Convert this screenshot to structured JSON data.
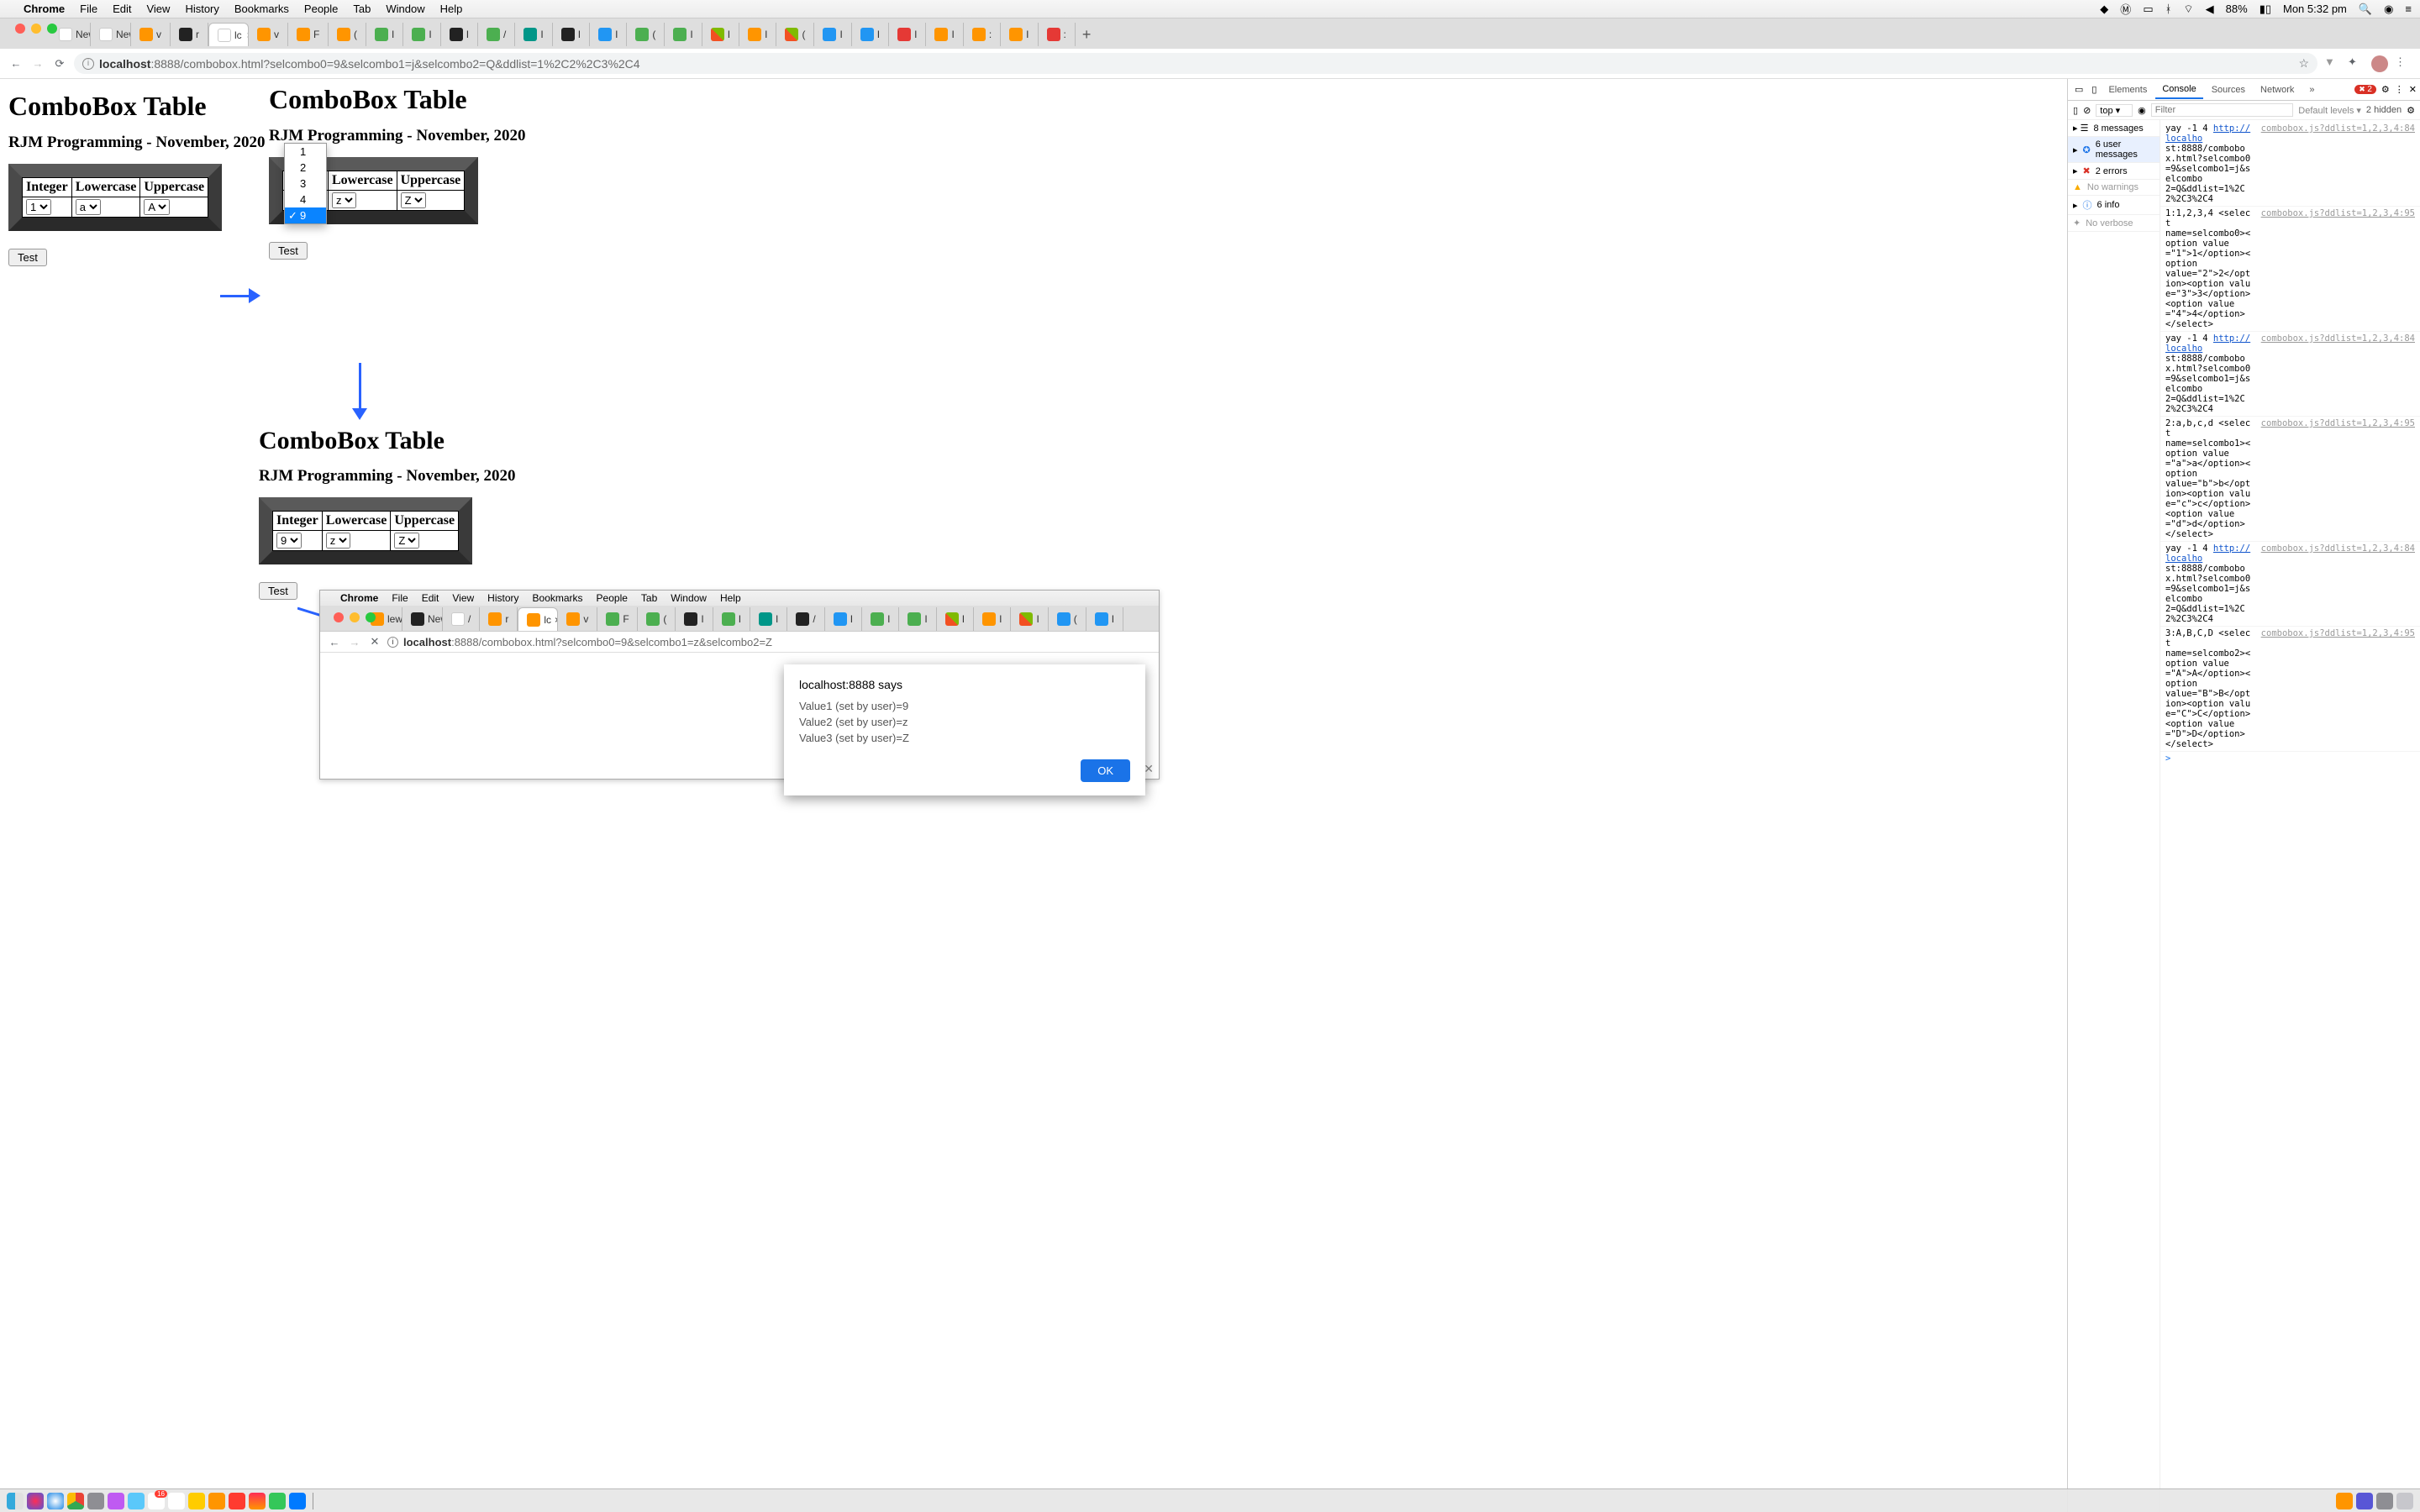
{
  "menubar": {
    "app": "Chrome",
    "items": [
      "File",
      "Edit",
      "View",
      "History",
      "Bookmarks",
      "People",
      "Tab",
      "Window",
      "Help"
    ],
    "battery": "88%",
    "clock": "Mon 5:32 pm"
  },
  "tabs": [
    {
      "label": "New"
    },
    {
      "label": "New"
    },
    {
      "label": "v"
    },
    {
      "label": "r"
    },
    {
      "label": "lc",
      "active": true,
      "close": "×"
    },
    {
      "label": "v"
    },
    {
      "label": "F"
    },
    {
      "label": "("
    },
    {
      "label": "I"
    },
    {
      "label": "I"
    },
    {
      "label": "I"
    },
    {
      "label": "/"
    },
    {
      "label": "I"
    },
    {
      "label": "I"
    },
    {
      "label": "I"
    },
    {
      "label": "("
    },
    {
      "label": "I"
    },
    {
      "label": "I"
    },
    {
      "label": "I"
    },
    {
      "label": "("
    },
    {
      "label": "I"
    },
    {
      "label": "I"
    },
    {
      "label": "I"
    },
    {
      "label": "I"
    },
    {
      "label": ":"
    },
    {
      "label": "I"
    },
    {
      "label": ":"
    }
  ],
  "url_prefix": "localhost",
  "url_rest": ":8888/combobox.html?selcombo0=9&selcombo1=j&selcombo2=Q&ddlist=1%2C2%2C3%2C4",
  "page_title": "ComboBox Table",
  "page_subtitle": "RJM Programming - November, 2020",
  "table_headers": [
    "Integer",
    "Lowercase",
    "Uppercase"
  ],
  "p1_vals": [
    "1",
    "a",
    "A"
  ],
  "p2_vals_partial_header": "r",
  "p2_vals": [
    "z",
    "Z"
  ],
  "p3_vals": [
    "9",
    "z",
    "Z"
  ],
  "test_label": "Test",
  "dropdown_options": [
    "1",
    "2",
    "3",
    "4",
    "9"
  ],
  "dropdown_selected_index": 4,
  "sub_menubar_items": [
    "Chrome",
    "File",
    "Edit",
    "View",
    "History",
    "Bookmarks",
    "People",
    "Tab",
    "Window",
    "Help"
  ],
  "sub_tabs": [
    {
      "label": "lew"
    },
    {
      "label": "New"
    },
    {
      "label": "/"
    },
    {
      "label": "r"
    },
    {
      "label": "lc",
      "active": true,
      "close": "×"
    },
    {
      "label": "v"
    },
    {
      "label": "F"
    },
    {
      "label": "("
    },
    {
      "label": "I"
    },
    {
      "label": "I"
    },
    {
      "label": "I"
    },
    {
      "label": "/"
    },
    {
      "label": "I"
    },
    {
      "label": "I"
    },
    {
      "label": "I"
    },
    {
      "label": "I"
    },
    {
      "label": "I"
    },
    {
      "label": "I"
    },
    {
      "label": "("
    },
    {
      "label": "I"
    }
  ],
  "sub_url_prefix": "localhost",
  "sub_url_rest": ":8888/combobox.html?selcombo0=9&selcombo1=z&selcombo2=Z",
  "alert": {
    "title": "localhost:8888 says",
    "lines": [
      "Value1 (set by user)=9",
      "Value2 (set by user)=z",
      "Value3 (set by user)=Z"
    ],
    "ok": "OK"
  },
  "devtools": {
    "tabs": [
      "Elements",
      "Console",
      "Sources",
      "Network"
    ],
    "tabs_more": "»",
    "err_count": "2",
    "context": "top",
    "filter_placeholder": "Filter",
    "levels": "Default levels ▾",
    "hidden": "2 hidden",
    "sidebar": {
      "messages": "8 messages",
      "user_messages": "6 user messages",
      "errors": "2 errors",
      "warnings": "No warnings",
      "info": "6 info",
      "verbose": "No verbose"
    },
    "msgs": [
      {
        "txt": "yay -1 4 http://localho\nst:8888/combobox.html?selcombo0=9&selcombo1=j&selcombo\n2=Q&ddlist=1%2C2%2C3%2C4",
        "src": "combobox.js?ddlist=1,2,3,4:84"
      },
      {
        "txt": "1:1,2,3,4 <select\nname=selcombo0><option value=\"1\">1</option><option\nvalue=\"2\">2</option><option value=\"3\">3</option>\n<option value=\"4\">4</option></select>",
        "src": "combobox.js?ddlist=1,2,3,4:95"
      },
      {
        "txt": "yay -1 4 http://localho\nst:8888/combobox.html?selcombo0=9&selcombo1=j&selcombo\n2=Q&ddlist=1%2C2%2C3%2C4",
        "src": "combobox.js?ddlist=1,2,3,4:84"
      },
      {
        "txt": "2:a,b,c,d <select\nname=selcombo1><option value=\"a\">a</option><option\nvalue=\"b\">b</option><option value=\"c\">c</option>\n<option value=\"d\">d</option></select>",
        "src": "combobox.js?ddlist=1,2,3,4:95"
      },
      {
        "txt": "yay -1 4 http://localho\nst:8888/combobox.html?selcombo0=9&selcombo1=j&selcombo\n2=Q&ddlist=1%2C2%2C3%2C4",
        "src": "combobox.js?ddlist=1,2,3,4:84"
      },
      {
        "txt": "3:A,B,C,D <select\nname=selcombo2><option value=\"A\">A</option><option\nvalue=\"B\">B</option><option value=\"C\">C</option>\n<option value=\"D\">D</option></select>",
        "src": "combobox.js?ddlist=1,2,3,4:95"
      }
    ]
  }
}
